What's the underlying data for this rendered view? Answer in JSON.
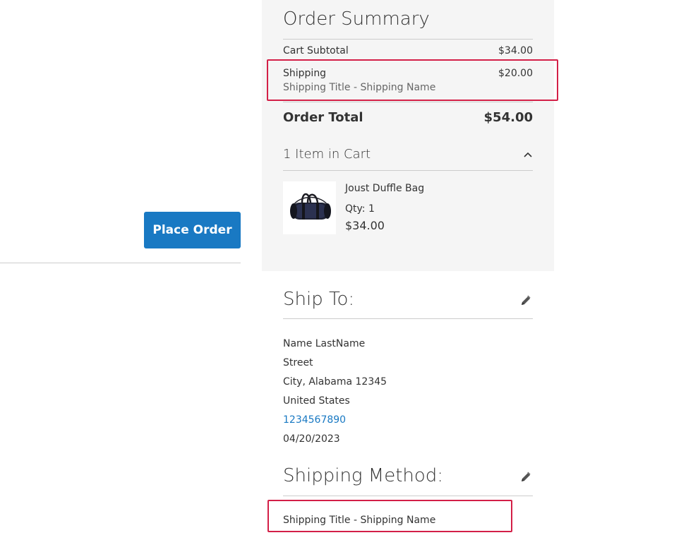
{
  "left": {
    "place_order_label": "Place Order"
  },
  "summary": {
    "title": "Order Summary",
    "subtotal_label": "Cart Subtotal",
    "subtotal_value": "$34.00",
    "shipping_label": "Shipping",
    "shipping_value": "$20.00",
    "shipping_method": "Shipping Title - Shipping Name",
    "total_label": "Order Total",
    "total_value": "$54.00",
    "items_in_cart": "1 Item in Cart",
    "items": [
      {
        "name": "Joust Duffle Bag",
        "qty": "Qty: 1",
        "price": "$34.00",
        "thumbnail_icon": "duffle-bag-icon"
      }
    ]
  },
  "ship_to": {
    "title": "Ship To:",
    "lines": [
      "Name LastName",
      "Street",
      "City, Alabama 12345",
      "United States"
    ],
    "phone": "1234567890",
    "date": "04/20/2023"
  },
  "shipping_method": {
    "title": "Shipping Method:",
    "value": "Shipping Title - Shipping Name"
  },
  "colors": {
    "primary": "#1979c3",
    "highlight": "#d31f47",
    "panel_bg": "#f5f5f5"
  }
}
